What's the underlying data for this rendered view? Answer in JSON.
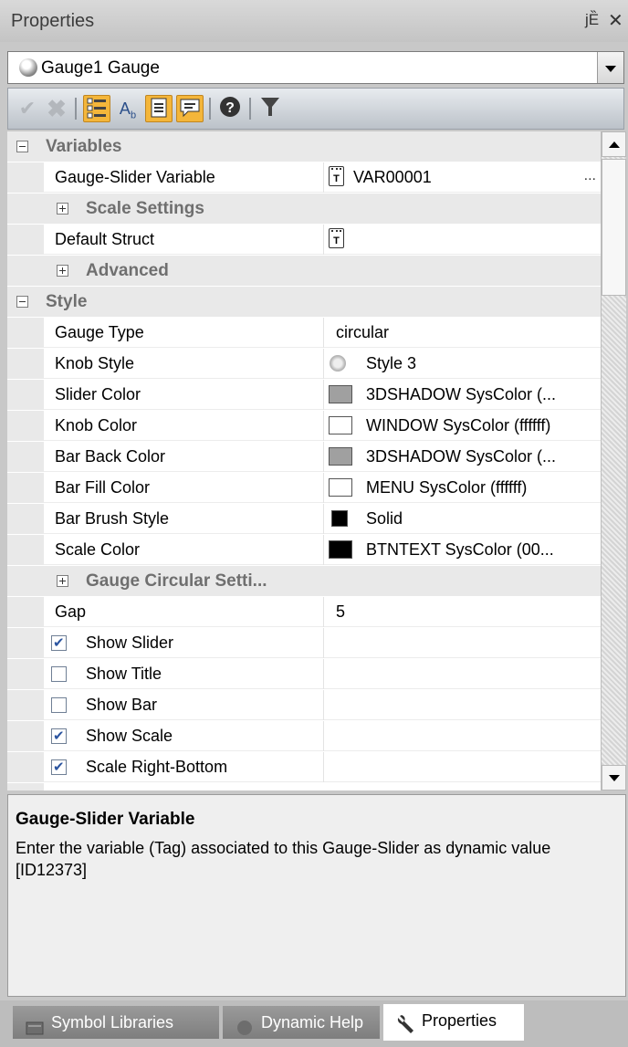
{
  "panel": {
    "title": "Properties",
    "pin_glyph": " ј",
    "close_glyph": "×"
  },
  "object_selector": {
    "value": "Gauge1 Gauge",
    "icon": "gauge-icon"
  },
  "toolbar": {
    "buttons": [
      {
        "name": "apply-check-icon"
      },
      {
        "name": "cancel-x-icon"
      },
      {
        "name": "categorized-icon"
      },
      {
        "name": "alphabetical-icon"
      },
      {
        "name": "property-pages-icon"
      },
      {
        "name": "events-icon"
      },
      {
        "name": "help-icon"
      },
      {
        "name": "filter-icon"
      }
    ]
  },
  "grid": {
    "categories": {
      "variables": "Variables",
      "scale_settings": "Scale Settings",
      "advanced": "Advanced",
      "style": "Style",
      "gauge_circular": "Gauge Circular Setti..."
    },
    "rows": {
      "gauge_slider_variable": {
        "name": "Gauge-Slider Variable",
        "value": "VAR00001",
        "ellipsis": "..."
      },
      "default_struct": {
        "name": "Default Struct",
        "value": ""
      },
      "gauge_type": {
        "name": "Gauge Type",
        "value": "circular"
      },
      "knob_style": {
        "name": "Knob Style",
        "value": "Style 3"
      },
      "slider_color": {
        "name": "Slider Color",
        "value": "3DSHADOW SysColor (...",
        "swatch": "#a0a0a0"
      },
      "knob_color": {
        "name": "Knob Color",
        "value": "WINDOW SysColor (ffffff)",
        "swatch": "#ffffff"
      },
      "bar_back_color": {
        "name": "Bar Back Color",
        "value": "3DSHADOW SysColor (...",
        "swatch": "#a0a0a0"
      },
      "bar_fill_color": {
        "name": "Bar Fill Color",
        "value": "MENU SysColor (ffffff)",
        "swatch": "#ffffff"
      },
      "bar_brush_style": {
        "name": "Bar Brush Style",
        "value": "Solid",
        "swatch": "#000000"
      },
      "scale_color": {
        "name": "Scale Color",
        "value": "BTNTEXT SysColor (00...",
        "swatch": "#000000"
      },
      "gap": {
        "name": "Gap",
        "value": "5"
      },
      "show_slider": {
        "name": "Show Slider",
        "checked": true
      },
      "show_title": {
        "name": "Show Title",
        "checked": false
      },
      "show_bar": {
        "name": "Show Bar",
        "checked": false
      },
      "show_scale": {
        "name": "Show Scale",
        "checked": true
      },
      "scale_right_bottom": {
        "name": "Scale Right-Bottom",
        "checked": true
      }
    }
  },
  "help": {
    "title": "Gauge-Slider Variable",
    "description": "Enter the variable (Tag) associated to this Gauge-Slider as dynamic value [ID12373]"
  },
  "tabs": [
    {
      "label": "Symbol Libraries",
      "active": false
    },
    {
      "label": "Dynamic Help",
      "active": false
    },
    {
      "label": "Properties",
      "active": true
    }
  ]
}
